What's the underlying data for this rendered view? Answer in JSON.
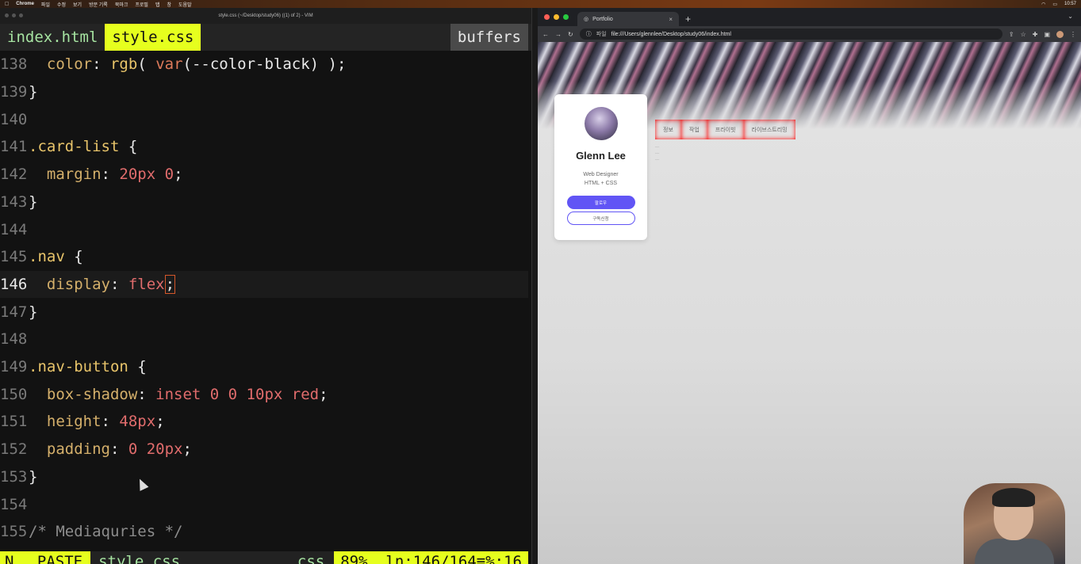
{
  "menubar": {
    "app": "Chrome",
    "items": [
      "파일",
      "수정",
      "보기",
      "방문 기록",
      "북마크",
      "프로필",
      "탭",
      "창",
      "도움말"
    ],
    "time": "10:57"
  },
  "vim": {
    "window_title": "style.css (~/Desktop/study06) ((1) of 2) - VIM",
    "tabs": [
      "index.html",
      "style.css"
    ],
    "buffers_label": "buffers",
    "lines": [
      {
        "n": "138",
        "tokens": [
          [
            "",
            "  "
          ],
          [
            "t-prop",
            "color"
          ],
          [
            "t-punc",
            ": "
          ],
          [
            "t-fn",
            "rgb"
          ],
          [
            "t-punc",
            "( "
          ],
          [
            "t-var",
            "var"
          ],
          [
            "t-punc",
            "(--color-black) );"
          ]
        ]
      },
      {
        "n": "139",
        "tokens": [
          [
            "t-punc",
            "}"
          ]
        ]
      },
      {
        "n": "140",
        "tokens": []
      },
      {
        "n": "141",
        "tokens": [
          [
            "t-sel",
            ".card-list"
          ],
          [
            "t-punc",
            " {"
          ]
        ]
      },
      {
        "n": "142",
        "tokens": [
          [
            "",
            "  "
          ],
          [
            "t-prop",
            "margin"
          ],
          [
            "t-punc",
            ": "
          ],
          [
            "t-val",
            "20px 0"
          ],
          [
            "t-punc",
            ";"
          ]
        ]
      },
      {
        "n": "143",
        "tokens": [
          [
            "t-punc",
            "}"
          ]
        ]
      },
      {
        "n": "144",
        "tokens": []
      },
      {
        "n": "145",
        "tokens": [
          [
            "t-sel",
            ".nav"
          ],
          [
            "t-punc",
            " {"
          ]
        ]
      },
      {
        "n": "146",
        "cursor": true,
        "tokens": [
          [
            "",
            "  "
          ],
          [
            "t-prop",
            "display"
          ],
          [
            "t-punc",
            ": "
          ],
          [
            "t-val",
            "flex"
          ],
          [
            "t-punc cursorbox",
            ";"
          ]
        ]
      },
      {
        "n": "147",
        "tokens": [
          [
            "t-punc",
            "}"
          ]
        ]
      },
      {
        "n": "148",
        "tokens": []
      },
      {
        "n": "149",
        "tokens": [
          [
            "t-sel",
            ".nav-button"
          ],
          [
            "t-punc",
            " {"
          ]
        ]
      },
      {
        "n": "150",
        "tokens": [
          [
            "",
            "  "
          ],
          [
            "t-prop",
            "box-shadow"
          ],
          [
            "t-punc",
            ": "
          ],
          [
            "t-val",
            "inset 0 0 10px red"
          ],
          [
            "t-punc",
            ";"
          ]
        ]
      },
      {
        "n": "151",
        "tokens": [
          [
            "",
            "  "
          ],
          [
            "t-prop",
            "height"
          ],
          [
            "t-punc",
            ": "
          ],
          [
            "t-val",
            "48px"
          ],
          [
            "t-punc",
            ";"
          ]
        ]
      },
      {
        "n": "152",
        "tokens": [
          [
            "",
            "  "
          ],
          [
            "t-prop",
            "padding"
          ],
          [
            "t-punc",
            ": "
          ],
          [
            "t-val",
            "0 20px"
          ],
          [
            "t-punc",
            ";"
          ]
        ]
      },
      {
        "n": "153",
        "tokens": [
          [
            "t-punc",
            "}"
          ]
        ]
      },
      {
        "n": "154",
        "tokens": []
      },
      {
        "n": "155",
        "tokens": [
          [
            "t-com",
            "/* Mediaquries */"
          ]
        ]
      }
    ],
    "status": {
      "mode": "N…",
      "paste": "PASTE",
      "file": "style.css",
      "filetype": "css",
      "position": "89%  ln:146/164≡%:16"
    }
  },
  "chrome": {
    "tab_title": "Portfolio",
    "tab_close": "×",
    "new_tab": "+",
    "url_scheme": "파일",
    "url": "file:///Users/glennlee/Desktop/study06/index.html",
    "profile": {
      "name": "Glenn Lee",
      "role_line1": "Web Designer",
      "role_line2": "HTML + CSS",
      "follow_label": "팔로우",
      "subscribe_label": "구독신청"
    },
    "nav": [
      "정보",
      "작업",
      "프라이빗",
      "라이브스트리밍"
    ],
    "list_items": [
      "...",
      "...",
      "..."
    ],
    "accent": "#6155f5"
  }
}
